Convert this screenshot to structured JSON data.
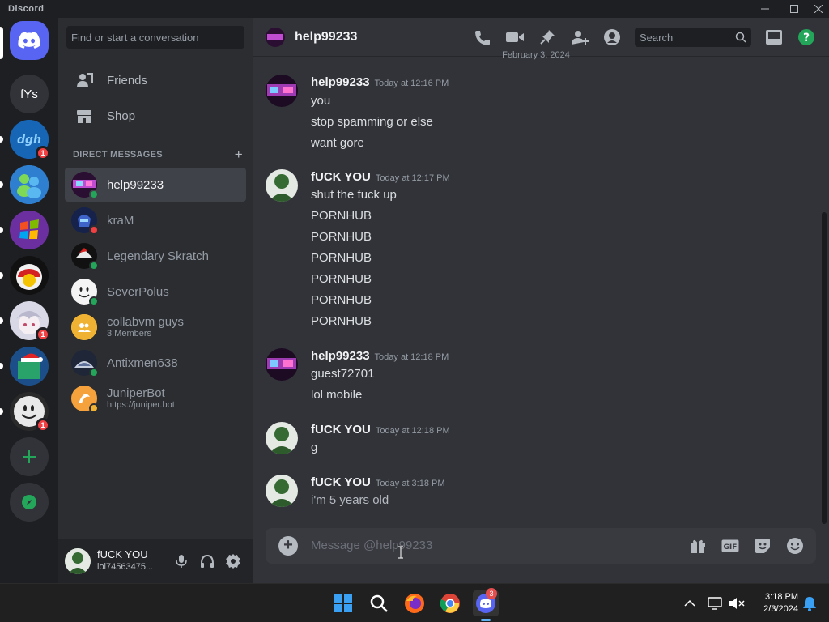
{
  "app": {
    "title": "Discord"
  },
  "sidebar_servers": {
    "home_label": "Discord home",
    "fys_label": "fYs",
    "badges": [
      "1",
      "1",
      "1"
    ]
  },
  "dm_panel": {
    "search_placeholder": "Find or start a conversation",
    "friends_label": "Friends",
    "shop_label": "Shop",
    "dm_header": "DIRECT MESSAGES",
    "items": [
      {
        "name": "help99233",
        "sub": "",
        "status": "online"
      },
      {
        "name": "kraM",
        "sub": "",
        "status": "dnd"
      },
      {
        "name": "Legendary Skratch",
        "sub": "",
        "status": "online"
      },
      {
        "name": "SeverPolus",
        "sub": "",
        "status": "online"
      },
      {
        "name": "collabvm guys",
        "sub": "3 Members",
        "status": ""
      },
      {
        "name": "Antixmen638",
        "sub": "",
        "status": "online"
      },
      {
        "name": "JuniperBot",
        "sub": "https://juniper.bot",
        "status": "idle"
      }
    ]
  },
  "user_bar": {
    "username": "fUCK YOU",
    "tag": "lol74563475..."
  },
  "chat": {
    "title": "help99233",
    "search_placeholder": "Search",
    "date_divider": "February 3, 2024",
    "messages": [
      {
        "author": "help99233",
        "time": "Today at 12:16 PM",
        "lines": [
          "you",
          "stop spamming or else",
          "want gore"
        ]
      },
      {
        "author": "fUCK YOU",
        "time": "Today at 12:17 PM",
        "lines": [
          "shut the fuck up",
          "PORNHUB",
          "PORNHUB",
          "PORNHUB",
          "PORNHUB",
          "PORNHUB",
          "PORNHUB"
        ]
      },
      {
        "author": "help99233",
        "time": "Today at 12:18 PM",
        "lines": [
          "guest72701",
          "lol mobile"
        ]
      },
      {
        "author": "fUCK YOU",
        "time": "Today at 12:18 PM",
        "lines": [
          "g"
        ]
      },
      {
        "author": "fUCK YOU",
        "time": "Today at 3:18 PM",
        "lines": [
          "i'm 5 years old"
        ]
      }
    ],
    "composer_placeholder": "Message @help99233",
    "gif_label": "GIF"
  },
  "taskbar": {
    "discord_badge": "3",
    "time": "3:18 PM",
    "date": "2/3/2024"
  },
  "colors": {
    "online": "#23a55a",
    "dnd": "#f23f42",
    "idle": "#f0b232",
    "blurple": "#5865f2",
    "green_add": "#23a55a"
  }
}
